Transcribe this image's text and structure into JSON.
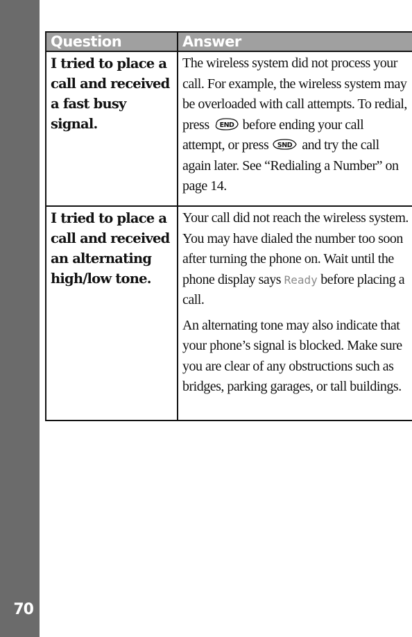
{
  "page": {
    "number": "70"
  },
  "table": {
    "headers": {
      "question": "Question",
      "answer": "Answer"
    },
    "rows": [
      {
        "question": "I tried to place a call and received a fast busy signal.",
        "answer": {
          "part1": "The wireless system did not process your call. For example, the wireless system may be overloaded with call attempts. To redial, press",
          "key1": {
            "icon": "end-key-icon",
            "label": "END"
          },
          "part2": "before ending your call attempt, or press",
          "key2": {
            "icon": "send-key-icon",
            "label": "SND"
          },
          "part3": "and try the call again later. See “Redialing a Number” on page 14."
        }
      },
      {
        "question": "I tried to place a call and received an alternating high/low tone.",
        "answer": {
          "p1_part1": "Your call did not reach the wireless system. You may have dialed the number too soon after turning the phone on. Wait until the phone display says",
          "p1_display_text": "Ready",
          "p1_part2": "before placing a call.",
          "p2": "An alternating tone may also indicate that your phone’s signal is blocked. Make sure you are clear of any obstructions such as bridges, parking garages, or tall buildings."
        }
      }
    ]
  }
}
